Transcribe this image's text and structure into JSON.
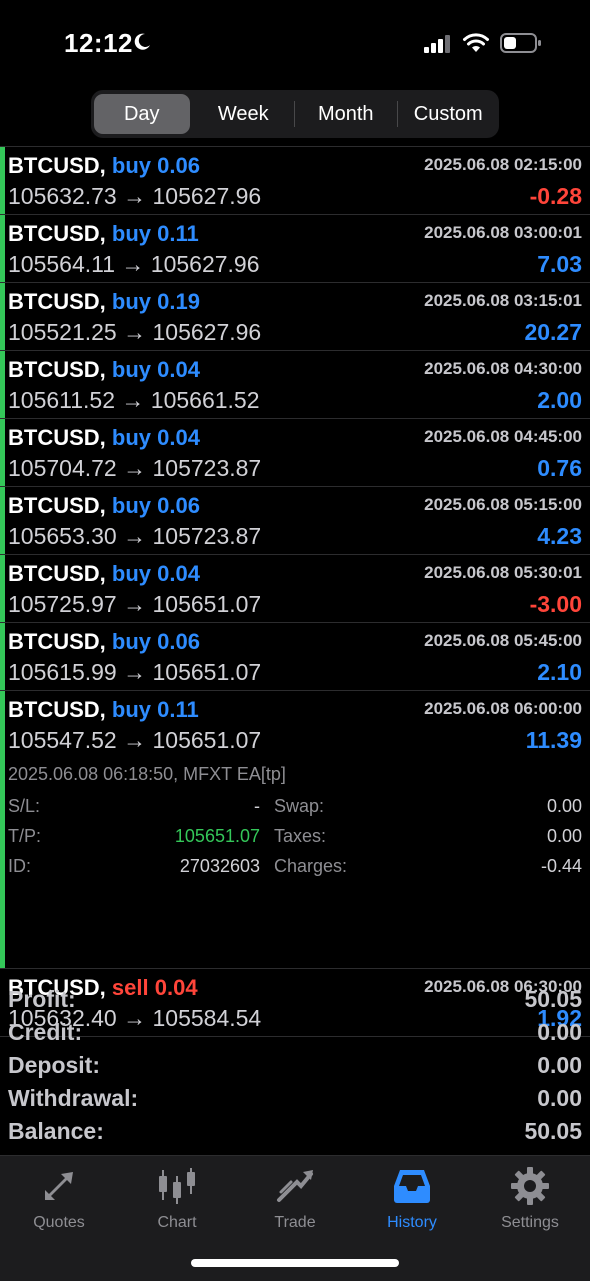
{
  "status": {
    "time": "12:12"
  },
  "segments": [
    "Day",
    "Week",
    "Month",
    "Custom"
  ],
  "active_segment": "Day",
  "trades": [
    {
      "symbol": "BTCUSD,",
      "side": "buy",
      "volume": "0.06",
      "date": "2025.06.08 02:15:00",
      "prices": "105632.73 → 105627.96",
      "profit": "-0.28",
      "negative": true
    },
    {
      "symbol": "BTCUSD,",
      "side": "buy",
      "volume": "0.11",
      "date": "2025.06.08 03:00:01",
      "prices": "105564.11 → 105627.96",
      "profit": "7.03",
      "negative": false
    },
    {
      "symbol": "BTCUSD,",
      "side": "buy",
      "volume": "0.19",
      "date": "2025.06.08 03:15:01",
      "prices": "105521.25 → 105627.96",
      "profit": "20.27",
      "negative": false
    },
    {
      "symbol": "BTCUSD,",
      "side": "buy",
      "volume": "0.04",
      "date": "2025.06.08 04:30:00",
      "prices": "105611.52 → 105661.52",
      "profit": "2.00",
      "negative": false
    },
    {
      "symbol": "BTCUSD,",
      "side": "buy",
      "volume": "0.04",
      "date": "2025.06.08 04:45:00",
      "prices": "105704.72 → 105723.87",
      "profit": "0.76",
      "negative": false
    },
    {
      "symbol": "BTCUSD,",
      "side": "buy",
      "volume": "0.06",
      "date": "2025.06.08 05:15:00",
      "prices": "105653.30 → 105723.87",
      "profit": "4.23",
      "negative": false
    },
    {
      "symbol": "BTCUSD,",
      "side": "buy",
      "volume": "0.04",
      "date": "2025.06.08 05:30:01",
      "prices": "105725.97 → 105651.07",
      "profit": "-3.00",
      "negative": true
    },
    {
      "symbol": "BTCUSD,",
      "side": "buy",
      "volume": "0.06",
      "date": "2025.06.08 05:45:00",
      "prices": "105615.99 → 105651.07",
      "profit": "2.10",
      "negative": false
    },
    {
      "symbol": "BTCUSD,",
      "side": "buy",
      "volume": "0.11",
      "date": "2025.06.08 06:00:00",
      "prices": "105547.52 → 105651.07",
      "profit": "11.39",
      "negative": false
    }
  ],
  "detail": {
    "meta": "2025.06.08 06:18:50, MFXT EA[tp]",
    "sl_label": "S/L:",
    "sl_value": "-",
    "tp_label": "T/P:",
    "tp_value": "105651.07",
    "id_label": "ID:",
    "id_value": "27032603",
    "swap_label": "Swap:",
    "swap_value": "0.00",
    "taxes_label": "Taxes:",
    "taxes_value": "0.00",
    "charges_label": "Charges:",
    "charges_value": "-0.44"
  },
  "last_trade": {
    "symbol": "BTCUSD,",
    "side": "sell",
    "volume": "0.04",
    "date": "2025.06.08 06:30:00",
    "prices": "105632.40 → 105584.54",
    "profit": "1.92",
    "negative": false
  },
  "summary": [
    {
      "label": "Profit:",
      "value": "50.05"
    },
    {
      "label": "Credit:",
      "value": "0.00"
    },
    {
      "label": "Deposit:",
      "value": "0.00"
    },
    {
      "label": "Withdrawal:",
      "value": "0.00"
    },
    {
      "label": "Balance:",
      "value": "50.05"
    }
  ],
  "tabs": [
    {
      "label": "Quotes",
      "icon": "quotes-icon"
    },
    {
      "label": "Chart",
      "icon": "chart-icon"
    },
    {
      "label": "Trade",
      "icon": "trade-icon"
    },
    {
      "label": "History",
      "icon": "history-icon"
    },
    {
      "label": "Settings",
      "icon": "settings-icon"
    }
  ],
  "active_tab": "History",
  "colors": {
    "buy": "#2e8cff",
    "sell": "#ff453a",
    "accent": "#2e8cff",
    "green": "#34c759"
  }
}
